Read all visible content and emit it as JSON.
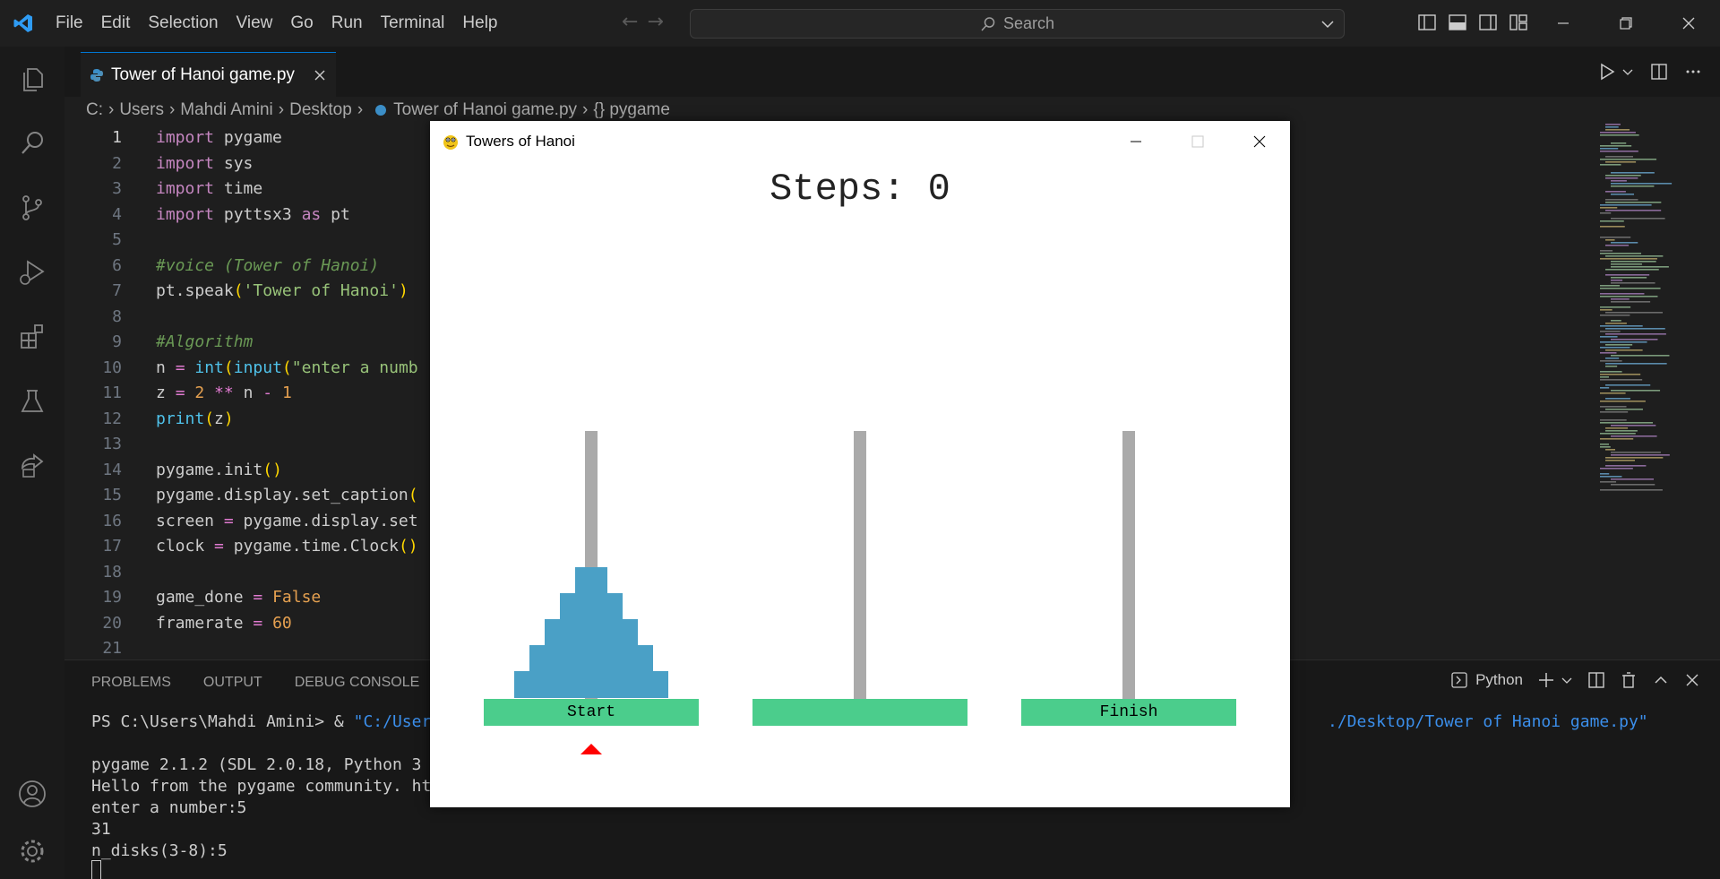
{
  "menu": [
    "File",
    "Edit",
    "Selection",
    "View",
    "Go",
    "Run",
    "Terminal",
    "Help"
  ],
  "search": {
    "label": "Search"
  },
  "tab": {
    "filename": "Tower of Hanoi game.py"
  },
  "breadcrumb": [
    "C:",
    "Users",
    "Mahdi Amini",
    "Desktop",
    "Tower of Hanoi game.py",
    "{} pygame"
  ],
  "code_lines": [
    {
      "n": "1",
      "text": "import pygame"
    },
    {
      "n": "2",
      "text": "import sys"
    },
    {
      "n": "3",
      "text": "import time"
    },
    {
      "n": "4",
      "text": "import pyttsx3 as pt"
    },
    {
      "n": "5",
      "text": ""
    },
    {
      "n": "6",
      "text": "#voice (Tower of Hanoi)"
    },
    {
      "n": "7",
      "text": "pt.speak('Tower of Hanoi')"
    },
    {
      "n": "8",
      "text": ""
    },
    {
      "n": "9",
      "text": "#Algorithm"
    },
    {
      "n": "10",
      "text": "n = int(input(\"enter a numb"
    },
    {
      "n": "11",
      "text": "z = 2 ** n - 1"
    },
    {
      "n": "12",
      "text": "print(z)"
    },
    {
      "n": "13",
      "text": ""
    },
    {
      "n": "14",
      "text": "pygame.init()"
    },
    {
      "n": "15",
      "text": "pygame.display.set_caption("
    },
    {
      "n": "16",
      "text": "screen = pygame.display.set"
    },
    {
      "n": "17",
      "text": "clock = pygame.time.Clock()"
    },
    {
      "n": "18",
      "text": ""
    },
    {
      "n": "19",
      "text": "game_done = False"
    },
    {
      "n": "20",
      "text": "framerate = 60"
    },
    {
      "n": "21",
      "text": ""
    }
  ],
  "panel": {
    "tabs": [
      "PROBLEMS",
      "OUTPUT",
      "DEBUG CONSOLE"
    ],
    "shell": "Python"
  },
  "terminal": [
    "PS C:\\Users\\Mahdi Amini> & \"C:/User",
    "",
    "pygame 2.1.2 (SDL 2.0.18, Python 3",
    "Hello from the pygame community. ht",
    "enter a number:5",
    "31",
    "n_disks(3-8):5"
  ],
  "terminal_right": "./Desktop/Tower of Hanoi game.py\"",
  "pygame_window": {
    "title": "Towers of Hanoi",
    "steps_label": "Steps: 0",
    "bases": [
      "Start",
      "",
      "Finish"
    ],
    "pegs": [
      {
        "disks": [
          5,
          4,
          3,
          2,
          1
        ]
      },
      {
        "disks": []
      },
      {
        "disks": []
      }
    ],
    "selected_peg": 0
  },
  "colors": {
    "keyword": "#c586c0",
    "function": "#dcdcaa",
    "builtin": "#4ec9b0",
    "string": "#ce9178",
    "number": "#b5cea8",
    "comment": "#6a9955",
    "disk": "#4aa0c6",
    "base": "#4bcd8c",
    "peg": "#aaaaaa",
    "marker": "#ff0000"
  }
}
